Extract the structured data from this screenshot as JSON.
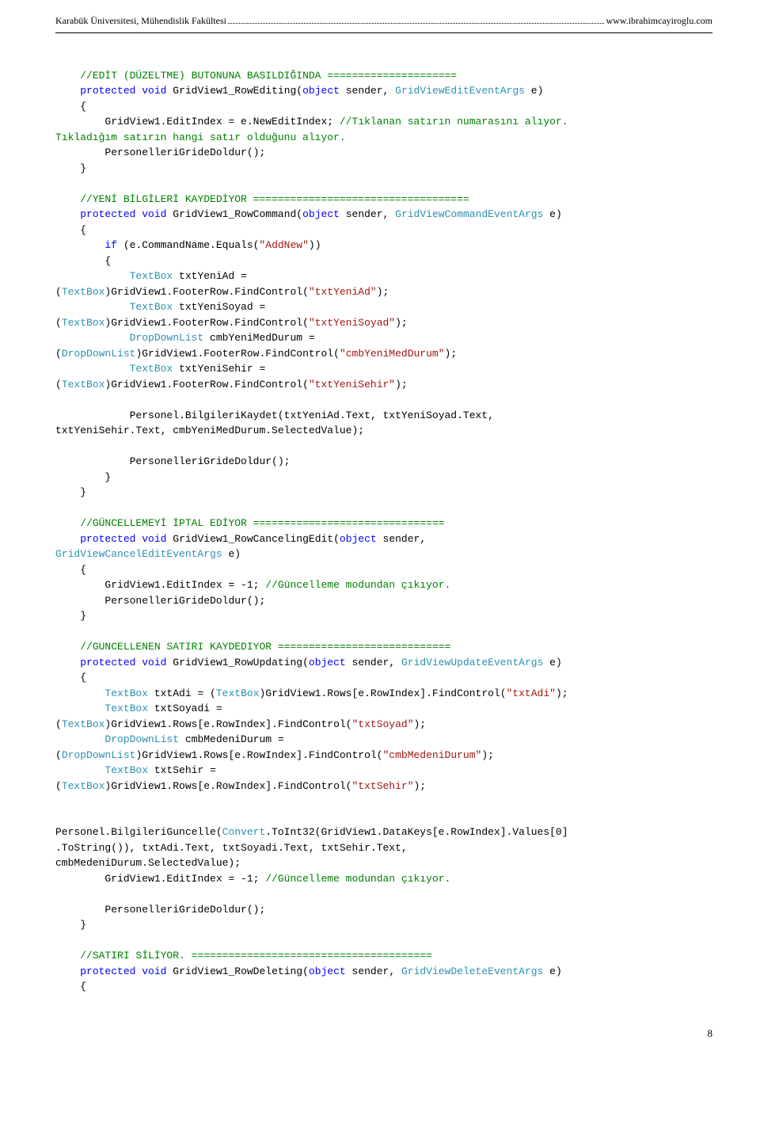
{
  "header": {
    "left": "Karabük Üniversitesi, Mühendislik Fakültesi",
    "right": "www.ibrahimcayiroglu.com"
  },
  "footer": {
    "page_number": "8"
  },
  "lines": [
    {
      "segs": [],
      "blank": true
    },
    {
      "segs": [
        {
          "t": "    ",
          "c": "black"
        },
        {
          "t": "//EDİT (DÜZELTME) BUTONUNA BASILDIĞINDA =====================",
          "c": "green"
        }
      ]
    },
    {
      "segs": [
        {
          "t": "    ",
          "c": "black"
        },
        {
          "t": "protected",
          "c": "blue"
        },
        {
          "t": " ",
          "c": "black"
        },
        {
          "t": "void",
          "c": "blue"
        },
        {
          "t": " GridView1_RowEditing(",
          "c": "black"
        },
        {
          "t": "object",
          "c": "blue"
        },
        {
          "t": " sender, ",
          "c": "black"
        },
        {
          "t": "GridViewEditEventArgs",
          "c": "teal"
        },
        {
          "t": " e)",
          "c": "black"
        }
      ]
    },
    {
      "segs": [
        {
          "t": "    {",
          "c": "black"
        }
      ]
    },
    {
      "segs": [
        {
          "t": "        GridView1.EditIndex = e.NewEditIndex; ",
          "c": "black"
        },
        {
          "t": "//Tıklanan satırın numarasını alıyor. ",
          "c": "green"
        }
      ]
    },
    {
      "segs": [
        {
          "t": "Tıkladığım satırın hangi satır olduğunu alıyor.",
          "c": "green"
        }
      ]
    },
    {
      "segs": [
        {
          "t": "        PersonelleriGrideDoldur();",
          "c": "black"
        }
      ]
    },
    {
      "segs": [
        {
          "t": "    }",
          "c": "black"
        }
      ]
    },
    {
      "segs": [],
      "blank": true
    },
    {
      "segs": [
        {
          "t": "    ",
          "c": "black"
        },
        {
          "t": "//YENİ BİLGİLERİ KAYDEDİYOR ===================================",
          "c": "green"
        }
      ]
    },
    {
      "segs": [
        {
          "t": "    ",
          "c": "black"
        },
        {
          "t": "protected",
          "c": "blue"
        },
        {
          "t": " ",
          "c": "black"
        },
        {
          "t": "void",
          "c": "blue"
        },
        {
          "t": " GridView1_RowCommand(",
          "c": "black"
        },
        {
          "t": "object",
          "c": "blue"
        },
        {
          "t": " sender, ",
          "c": "black"
        },
        {
          "t": "GridViewCommandEventArgs",
          "c": "teal"
        },
        {
          "t": " e)",
          "c": "black"
        }
      ]
    },
    {
      "segs": [
        {
          "t": "    {",
          "c": "black"
        }
      ]
    },
    {
      "segs": [
        {
          "t": "        ",
          "c": "black"
        },
        {
          "t": "if",
          "c": "blue"
        },
        {
          "t": " (e.CommandName.Equals(",
          "c": "black"
        },
        {
          "t": "\"AddNew\"",
          "c": "red"
        },
        {
          "t": "))",
          "c": "black"
        }
      ]
    },
    {
      "segs": [
        {
          "t": "        {",
          "c": "black"
        }
      ]
    },
    {
      "segs": [
        {
          "t": "            ",
          "c": "black"
        },
        {
          "t": "TextBox",
          "c": "teal"
        },
        {
          "t": " txtYeniAd = ",
          "c": "black"
        }
      ]
    },
    {
      "segs": [
        {
          "t": "(",
          "c": "black"
        },
        {
          "t": "TextBox",
          "c": "teal"
        },
        {
          "t": ")GridView1.FooterRow.FindControl(",
          "c": "black"
        },
        {
          "t": "\"txtYeniAd\"",
          "c": "red"
        },
        {
          "t": ");",
          "c": "black"
        }
      ]
    },
    {
      "segs": [
        {
          "t": "            ",
          "c": "black"
        },
        {
          "t": "TextBox",
          "c": "teal"
        },
        {
          "t": " txtYeniSoyad = ",
          "c": "black"
        }
      ]
    },
    {
      "segs": [
        {
          "t": "(",
          "c": "black"
        },
        {
          "t": "TextBox",
          "c": "teal"
        },
        {
          "t": ")GridView1.FooterRow.FindControl(",
          "c": "black"
        },
        {
          "t": "\"txtYeniSoyad\"",
          "c": "red"
        },
        {
          "t": ");",
          "c": "black"
        }
      ]
    },
    {
      "segs": [
        {
          "t": "            ",
          "c": "black"
        },
        {
          "t": "DropDownList",
          "c": "teal"
        },
        {
          "t": " cmbYeniMedDurum = ",
          "c": "black"
        }
      ]
    },
    {
      "segs": [
        {
          "t": "(",
          "c": "black"
        },
        {
          "t": "DropDownList",
          "c": "teal"
        },
        {
          "t": ")GridView1.FooterRow.FindControl(",
          "c": "black"
        },
        {
          "t": "\"cmbYeniMedDurum\"",
          "c": "red"
        },
        {
          "t": ");",
          "c": "black"
        }
      ]
    },
    {
      "segs": [
        {
          "t": "            ",
          "c": "black"
        },
        {
          "t": "TextBox",
          "c": "teal"
        },
        {
          "t": " txtYeniSehir = ",
          "c": "black"
        }
      ]
    },
    {
      "segs": [
        {
          "t": "(",
          "c": "black"
        },
        {
          "t": "TextBox",
          "c": "teal"
        },
        {
          "t": ")GridView1.FooterRow.FindControl(",
          "c": "black"
        },
        {
          "t": "\"txtYeniSehir\"",
          "c": "red"
        },
        {
          "t": ");",
          "c": "black"
        }
      ]
    },
    {
      "segs": [],
      "blank": true
    },
    {
      "segs": [
        {
          "t": "            Personel.BilgileriKaydet(txtYeniAd.Text, txtYeniSoyad.Text, ",
          "c": "black"
        }
      ]
    },
    {
      "segs": [
        {
          "t": "txtYeniSehir.Text, cmbYeniMedDurum.SelectedValue);",
          "c": "black"
        }
      ]
    },
    {
      "segs": [],
      "blank": true
    },
    {
      "segs": [
        {
          "t": "            PersonelleriGrideDoldur();",
          "c": "black"
        }
      ]
    },
    {
      "segs": [
        {
          "t": "        }",
          "c": "black"
        }
      ]
    },
    {
      "segs": [
        {
          "t": "    }",
          "c": "black"
        }
      ]
    },
    {
      "segs": [],
      "blank": true
    },
    {
      "segs": [
        {
          "t": "    ",
          "c": "black"
        },
        {
          "t": "//GÜNCELLEMEYİ İPTAL EDİYOR ===============================",
          "c": "green"
        }
      ]
    },
    {
      "segs": [
        {
          "t": "    ",
          "c": "black"
        },
        {
          "t": "protected",
          "c": "blue"
        },
        {
          "t": " ",
          "c": "black"
        },
        {
          "t": "void",
          "c": "blue"
        },
        {
          "t": " GridView1_RowCancelingEdit(",
          "c": "black"
        },
        {
          "t": "object",
          "c": "blue"
        },
        {
          "t": " sender, ",
          "c": "black"
        }
      ]
    },
    {
      "segs": [
        {
          "t": "GridViewCancelEditEventArgs",
          "c": "teal"
        },
        {
          "t": " e)",
          "c": "black"
        }
      ]
    },
    {
      "segs": [
        {
          "t": "    {",
          "c": "black"
        }
      ]
    },
    {
      "segs": [
        {
          "t": "        GridView1.EditIndex = -1; ",
          "c": "black"
        },
        {
          "t": "//Güncelleme modundan çıkıyor.",
          "c": "green"
        }
      ]
    },
    {
      "segs": [
        {
          "t": "        PersonelleriGrideDoldur();",
          "c": "black"
        }
      ]
    },
    {
      "segs": [
        {
          "t": "    }",
          "c": "black"
        }
      ]
    },
    {
      "segs": [],
      "blank": true
    },
    {
      "segs": [
        {
          "t": "    ",
          "c": "black"
        },
        {
          "t": "//GUNCELLENEN SATIRI KAYDEDIYOR ============================",
          "c": "green"
        }
      ]
    },
    {
      "segs": [
        {
          "t": "    ",
          "c": "black"
        },
        {
          "t": "protected",
          "c": "blue"
        },
        {
          "t": " ",
          "c": "black"
        },
        {
          "t": "void",
          "c": "blue"
        },
        {
          "t": " GridView1_RowUpdating(",
          "c": "black"
        },
        {
          "t": "object",
          "c": "blue"
        },
        {
          "t": " sender, ",
          "c": "black"
        },
        {
          "t": "GridViewUpdateEventArgs",
          "c": "teal"
        },
        {
          "t": " e)",
          "c": "black"
        }
      ]
    },
    {
      "segs": [
        {
          "t": "    {",
          "c": "black"
        }
      ]
    },
    {
      "segs": [
        {
          "t": "        ",
          "c": "black"
        },
        {
          "t": "TextBox",
          "c": "teal"
        },
        {
          "t": " txtAdi = (",
          "c": "black"
        },
        {
          "t": "TextBox",
          "c": "teal"
        },
        {
          "t": ")GridView1.Rows[e.RowIndex].FindControl(",
          "c": "black"
        },
        {
          "t": "\"txtAdi\"",
          "c": "red"
        },
        {
          "t": ");",
          "c": "black"
        }
      ]
    },
    {
      "segs": [
        {
          "t": "        ",
          "c": "black"
        },
        {
          "t": "TextBox",
          "c": "teal"
        },
        {
          "t": " txtSoyadi = ",
          "c": "black"
        }
      ]
    },
    {
      "segs": [
        {
          "t": "(",
          "c": "black"
        },
        {
          "t": "TextBox",
          "c": "teal"
        },
        {
          "t": ")GridView1.Rows[e.RowIndex].FindControl(",
          "c": "black"
        },
        {
          "t": "\"txtSoyad\"",
          "c": "red"
        },
        {
          "t": ");",
          "c": "black"
        }
      ]
    },
    {
      "segs": [
        {
          "t": "        ",
          "c": "black"
        },
        {
          "t": "DropDownList",
          "c": "teal"
        },
        {
          "t": " cmbMedeniDurum = ",
          "c": "black"
        }
      ]
    },
    {
      "segs": [
        {
          "t": "(",
          "c": "black"
        },
        {
          "t": "DropDownList",
          "c": "teal"
        },
        {
          "t": ")GridView1.Rows[e.RowIndex].FindControl(",
          "c": "black"
        },
        {
          "t": "\"cmbMedeniDurum\"",
          "c": "red"
        },
        {
          "t": ");",
          "c": "black"
        }
      ]
    },
    {
      "segs": [
        {
          "t": "        ",
          "c": "black"
        },
        {
          "t": "TextBox",
          "c": "teal"
        },
        {
          "t": " txtSehir = ",
          "c": "black"
        }
      ]
    },
    {
      "segs": [
        {
          "t": "(",
          "c": "black"
        },
        {
          "t": "TextBox",
          "c": "teal"
        },
        {
          "t": ")GridView1.Rows[e.RowIndex].FindControl(",
          "c": "black"
        },
        {
          "t": "\"txtSehir\"",
          "c": "red"
        },
        {
          "t": ");",
          "c": "black"
        }
      ]
    },
    {
      "segs": [],
      "blank": true
    },
    {
      "segs": [],
      "blank": true
    },
    {
      "segs": [
        {
          "t": "Personel.BilgileriGuncelle(",
          "c": "black"
        },
        {
          "t": "Convert",
          "c": "teal"
        },
        {
          "t": ".ToInt32(GridView1.DataKeys[e.RowIndex].Values[0]",
          "c": "black"
        }
      ]
    },
    {
      "segs": [
        {
          "t": ".ToString()), txtAdi.Text, txtSoyadi.Text, txtSehir.Text, ",
          "c": "black"
        }
      ]
    },
    {
      "segs": [
        {
          "t": "cmbMedeniDurum.SelectedValue);",
          "c": "black"
        }
      ]
    },
    {
      "segs": [
        {
          "t": "        GridView1.EditIndex = -1; ",
          "c": "black"
        },
        {
          "t": "//Güncelleme modundan çıkıyor.",
          "c": "green"
        }
      ]
    },
    {
      "segs": [],
      "blank": true
    },
    {
      "segs": [
        {
          "t": "        PersonelleriGrideDoldur();",
          "c": "black"
        }
      ]
    },
    {
      "segs": [
        {
          "t": "    }",
          "c": "black"
        }
      ]
    },
    {
      "segs": [],
      "blank": true
    },
    {
      "segs": [
        {
          "t": "    ",
          "c": "black"
        },
        {
          "t": "//SATIRI SİLİYOR. =======================================",
          "c": "green"
        }
      ]
    },
    {
      "segs": [
        {
          "t": "    ",
          "c": "black"
        },
        {
          "t": "protected",
          "c": "blue"
        },
        {
          "t": " ",
          "c": "black"
        },
        {
          "t": "void",
          "c": "blue"
        },
        {
          "t": " GridView1_RowDeleting(",
          "c": "black"
        },
        {
          "t": "object",
          "c": "blue"
        },
        {
          "t": " sender, ",
          "c": "black"
        },
        {
          "t": "GridViewDeleteEventArgs",
          "c": "teal"
        },
        {
          "t": " e)",
          "c": "black"
        }
      ]
    },
    {
      "segs": [
        {
          "t": "    {",
          "c": "black"
        }
      ]
    }
  ]
}
